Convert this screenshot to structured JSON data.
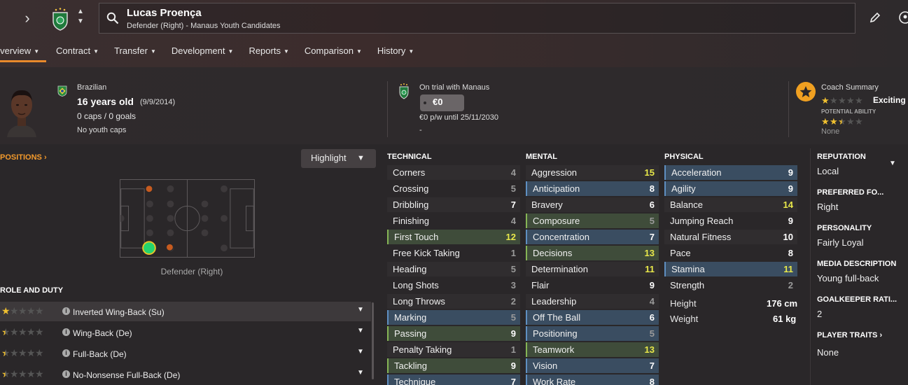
{
  "header": {
    "player_name": "Lucas Proença",
    "subtitle": "Defender (Right) - Manaus Youth Candidates"
  },
  "tabs": [
    {
      "label": "Overview"
    },
    {
      "label": "Contract"
    },
    {
      "label": "Transfer"
    },
    {
      "label": "Development"
    },
    {
      "label": "Reports"
    },
    {
      "label": "Comparison"
    },
    {
      "label": "History"
    }
  ],
  "info": {
    "nationality": "Brazilian",
    "age": "16 years old",
    "dob": "(9/9/2014)",
    "caps": "0 caps / 0 goals",
    "youth_caps": "No youth caps",
    "club_status": "On trial with Manaus",
    "value": "€0",
    "wage": "€0 p/w until 25/11/2030",
    "dash": "-",
    "coach_title": "Coach Summary",
    "coach_label": "Exciting",
    "pa_label": "POTENTIAL ABILITY",
    "pa_sub": "None",
    "current_ability_stars": 1.0,
    "potential_ability_stars": 2.5
  },
  "positions": {
    "heading": "POSITIONS",
    "highlight_label": "Highlight",
    "position_label": "Defender (Right)"
  },
  "roles": {
    "heading": "ROLE AND DUTY",
    "items": [
      {
        "name": "Inverted Wing-Back (Su)",
        "stars": 1.0
      },
      {
        "name": "Wing-Back (De)",
        "stars": 0.5
      },
      {
        "name": "Full-Back (De)",
        "stars": 0.5
      },
      {
        "name": "No-Nonsense Full-Back (De)",
        "stars": 0.5
      }
    ]
  },
  "technical": {
    "heading": "TECHNICAL",
    "items": [
      {
        "name": "Corners",
        "value": "4",
        "hl": "plain"
      },
      {
        "name": "Crossing",
        "value": "5",
        "hl": "plain2"
      },
      {
        "name": "Dribbling",
        "value": "7",
        "hl": "plain"
      },
      {
        "name": "Finishing",
        "value": "4",
        "hl": "plain2"
      },
      {
        "name": "First Touch",
        "value": "12",
        "hl": "green"
      },
      {
        "name": "Free Kick Taking",
        "value": "1",
        "hl": "plain2"
      },
      {
        "name": "Heading",
        "value": "5",
        "hl": "plain"
      },
      {
        "name": "Long Shots",
        "value": "3",
        "hl": "plain2"
      },
      {
        "name": "Long Throws",
        "value": "2",
        "hl": "plain"
      },
      {
        "name": "Marking",
        "value": "5",
        "hl": "blue"
      },
      {
        "name": "Passing",
        "value": "9",
        "hl": "green"
      },
      {
        "name": "Penalty Taking",
        "value": "1",
        "hl": "plain"
      },
      {
        "name": "Tackling",
        "value": "9",
        "hl": "green"
      },
      {
        "name": "Technique",
        "value": "7",
        "hl": "blue"
      }
    ]
  },
  "mental": {
    "heading": "MENTAL",
    "items": [
      {
        "name": "Aggression",
        "value": "15",
        "hl": "plain"
      },
      {
        "name": "Anticipation",
        "value": "8",
        "hl": "blue"
      },
      {
        "name": "Bravery",
        "value": "6",
        "hl": "plain"
      },
      {
        "name": "Composure",
        "value": "5",
        "hl": "green"
      },
      {
        "name": "Concentration",
        "value": "7",
        "hl": "blue"
      },
      {
        "name": "Decisions",
        "value": "13",
        "hl": "green"
      },
      {
        "name": "Determination",
        "value": "11",
        "hl": "plain"
      },
      {
        "name": "Flair",
        "value": "9",
        "hl": "plain2"
      },
      {
        "name": "Leadership",
        "value": "4",
        "hl": "plain"
      },
      {
        "name": "Off The Ball",
        "value": "6",
        "hl": "blue"
      },
      {
        "name": "Positioning",
        "value": "5",
        "hl": "blue"
      },
      {
        "name": "Teamwork",
        "value": "13",
        "hl": "green"
      },
      {
        "name": "Vision",
        "value": "7",
        "hl": "blue"
      },
      {
        "name": "Work Rate",
        "value": "8",
        "hl": "blue"
      }
    ]
  },
  "physical": {
    "heading": "PHYSICAL",
    "items": [
      {
        "name": "Acceleration",
        "value": "9",
        "hl": "blue"
      },
      {
        "name": "Agility",
        "value": "9",
        "hl": "blue"
      },
      {
        "name": "Balance",
        "value": "14",
        "hl": "plain"
      },
      {
        "name": "Jumping Reach",
        "value": "9",
        "hl": "plain2"
      },
      {
        "name": "Natural Fitness",
        "value": "10",
        "hl": "plain"
      },
      {
        "name": "Pace",
        "value": "8",
        "hl": "plain2"
      },
      {
        "name": "Stamina",
        "value": "11",
        "hl": "blue"
      },
      {
        "name": "Strength",
        "value": "2",
        "hl": "plain2"
      }
    ],
    "height_label": "Height",
    "height_value": "176 cm",
    "weight_label": "Weight",
    "weight_value": "61 kg"
  },
  "sidebar": {
    "reputation_h": "REPUTATION",
    "reputation_v": "Local",
    "foot_h": "PREFERRED FO...",
    "foot_v": "Right",
    "personality_h": "PERSONALITY",
    "personality_v": "Fairly Loyal",
    "media_h": "MEDIA DESCRIPTION",
    "media_v": "Young full-back",
    "gk_h": "GOALKEEPER RATI...",
    "gk_v": "2",
    "traits_h": "PLAYER TRAITS",
    "traits_v": "None"
  },
  "colors": {
    "accent": "#e8892b",
    "highlight_value": "#e8e84a",
    "blue_row": "#3a4d61",
    "green_row": "#3f4c3a"
  }
}
